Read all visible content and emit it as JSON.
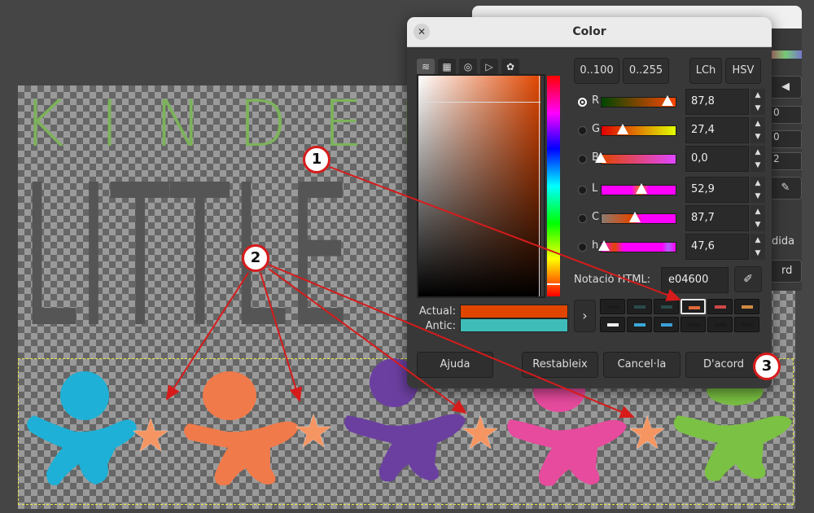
{
  "canvas": {
    "kinder_text": "KINDER",
    "little_text": "LITTLE"
  },
  "background_dialog": {
    "spin_values": [
      "0",
      "0",
      "2"
    ],
    "partial_label": "dida",
    "partial_button": "rd"
  },
  "color_dialog": {
    "title": "Color",
    "close_glyph": "✕",
    "selector_tabs": [
      "water-color-icon",
      "cmyk-icon",
      "wheel-icon",
      "triangle-icon",
      "palette-icon"
    ],
    "range_buttons": [
      "0..100",
      "0..255"
    ],
    "model_buttons": [
      "LCh",
      "HSV"
    ],
    "channels": [
      {
        "label": "R",
        "value": "87,8",
        "selected": true
      },
      {
        "label": "G",
        "value": "27,4",
        "selected": false
      },
      {
        "label": "B",
        "value": "0,0",
        "selected": false
      },
      {
        "label": "L",
        "value": "52,9",
        "selected": false
      },
      {
        "label": "C",
        "value": "87,7",
        "selected": false
      },
      {
        "label": "h",
        "value": "47,6",
        "selected": false
      }
    ],
    "html_label": "Notació HTML:",
    "html_value": "e04600",
    "current_label": "Actual:",
    "old_label": "Antic:",
    "current_color": "#e04600",
    "old_color": "#3ebcb8",
    "history_colors": [
      "#1a1a1a",
      "#2a4a4a",
      "#2a4a4a",
      "#e06a3a",
      "#d04848",
      "#d08a40",
      "#f0f0f0",
      "#3aa8d8",
      "#3aa0d8",
      "#1a1a1a",
      "#1a1a1a",
      "#1a1a1a"
    ],
    "buttons": {
      "help": "Ajuda",
      "reset": "Restableix",
      "cancel": "Cancel·la",
      "ok": "D'acord"
    }
  },
  "callouts": [
    "1",
    "2",
    "3"
  ]
}
